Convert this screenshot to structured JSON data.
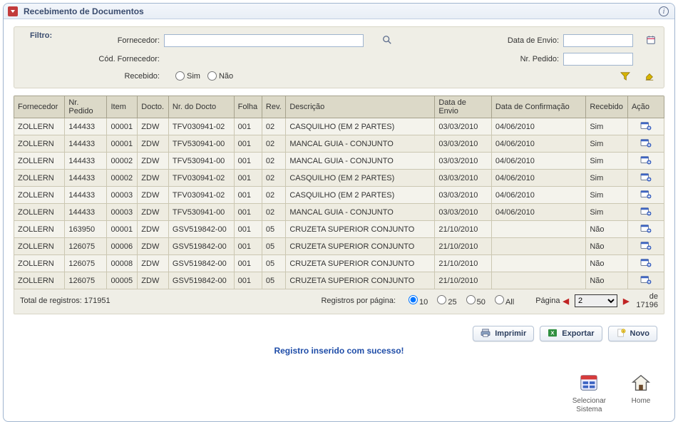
{
  "panel": {
    "title": "Recebimento de Documentos"
  },
  "filter": {
    "heading": "Filtro:",
    "fornecedor_label": "Fornecedor:",
    "fornecedor_value": "",
    "cod_fornecedor_label": "Cód. Fornecedor:",
    "data_envio_label": "Data de Envio:",
    "data_envio_value": "",
    "nr_pedido_label": "Nr. Pedido:",
    "nr_pedido_value": "",
    "recebido_label": "Recebido:",
    "sim": "Sim",
    "nao": "Não"
  },
  "columns": {
    "fornecedor": "Fornecedor",
    "nr_pedido": "Nr. Pedido",
    "item": "Item",
    "docto": "Docto.",
    "nr_docto": "Nr. do Docto",
    "folha": "Folha",
    "rev": "Rev.",
    "descricao": "Descrição",
    "data_envio": "Data de Envio",
    "data_conf": "Data de Confirmação",
    "recebido": "Recebido",
    "acao": "Ação"
  },
  "rows": [
    {
      "fornecedor": "ZOLLERN",
      "nr_pedido": "144433",
      "item": "00001",
      "docto": "ZDW",
      "nr_docto": "TFV030941-02",
      "folha": "001",
      "rev": "02",
      "descricao": "CASQUILHO (EM 2 PARTES)",
      "data_envio": "03/03/2010",
      "data_conf": "04/06/2010",
      "recebido": "Sim"
    },
    {
      "fornecedor": "ZOLLERN",
      "nr_pedido": "144433",
      "item": "00001",
      "docto": "ZDW",
      "nr_docto": "TFV530941-00",
      "folha": "001",
      "rev": "02",
      "descricao": "MANCAL GUIA - CONJUNTO",
      "data_envio": "03/03/2010",
      "data_conf": "04/06/2010",
      "recebido": "Sim"
    },
    {
      "fornecedor": "ZOLLERN",
      "nr_pedido": "144433",
      "item": "00002",
      "docto": "ZDW",
      "nr_docto": "TFV530941-00",
      "folha": "001",
      "rev": "02",
      "descricao": "MANCAL GUIA - CONJUNTO",
      "data_envio": "03/03/2010",
      "data_conf": "04/06/2010",
      "recebido": "Sim"
    },
    {
      "fornecedor": "ZOLLERN",
      "nr_pedido": "144433",
      "item": "00002",
      "docto": "ZDW",
      "nr_docto": "TFV030941-02",
      "folha": "001",
      "rev": "02",
      "descricao": "CASQUILHO (EM 2 PARTES)",
      "data_envio": "03/03/2010",
      "data_conf": "04/06/2010",
      "recebido": "Sim"
    },
    {
      "fornecedor": "ZOLLERN",
      "nr_pedido": "144433",
      "item": "00003",
      "docto": "ZDW",
      "nr_docto": "TFV030941-02",
      "folha": "001",
      "rev": "02",
      "descricao": "CASQUILHO (EM 2 PARTES)",
      "data_envio": "03/03/2010",
      "data_conf": "04/06/2010",
      "recebido": "Sim"
    },
    {
      "fornecedor": "ZOLLERN",
      "nr_pedido": "144433",
      "item": "00003",
      "docto": "ZDW",
      "nr_docto": "TFV530941-00",
      "folha": "001",
      "rev": "02",
      "descricao": "MANCAL GUIA - CONJUNTO",
      "data_envio": "03/03/2010",
      "data_conf": "04/06/2010",
      "recebido": "Sim"
    },
    {
      "fornecedor": "ZOLLERN",
      "nr_pedido": "163950",
      "item": "00001",
      "docto": "ZDW",
      "nr_docto": "GSV519842-00",
      "folha": "001",
      "rev": "05",
      "descricao": "CRUZETA SUPERIOR CONJUNTO",
      "data_envio": "21/10/2010",
      "data_conf": "",
      "recebido": "Não"
    },
    {
      "fornecedor": "ZOLLERN",
      "nr_pedido": "126075",
      "item": "00006",
      "docto": "ZDW",
      "nr_docto": "GSV519842-00",
      "folha": "001",
      "rev": "05",
      "descricao": "CRUZETA SUPERIOR CONJUNTO",
      "data_envio": "21/10/2010",
      "data_conf": "",
      "recebido": "Não"
    },
    {
      "fornecedor": "ZOLLERN",
      "nr_pedido": "126075",
      "item": "00008",
      "docto": "ZDW",
      "nr_docto": "GSV519842-00",
      "folha": "001",
      "rev": "05",
      "descricao": "CRUZETA SUPERIOR CONJUNTO",
      "data_envio": "21/10/2010",
      "data_conf": "",
      "recebido": "Não"
    },
    {
      "fornecedor": "ZOLLERN",
      "nr_pedido": "126075",
      "item": "00005",
      "docto": "ZDW",
      "nr_docto": "GSV519842-00",
      "folha": "001",
      "rev": "05",
      "descricao": "CRUZETA SUPERIOR CONJUNTO",
      "data_envio": "21/10/2010",
      "data_conf": "",
      "recebido": "Não"
    }
  ],
  "pager": {
    "total_label": "Total de registros:",
    "total_value": "171951",
    "perpage_label": "Registros por página:",
    "opt10": "10",
    "opt25": "25",
    "opt50": "50",
    "optAll": "All",
    "page_label": "Página",
    "current_page": "2",
    "de": "de",
    "total_pages": "17196"
  },
  "buttons": {
    "imprimir": "Imprimir",
    "exportar": "Exportar",
    "novo": "Novo"
  },
  "message": "Registro inserido com sucesso!",
  "tiles": {
    "selecionar": "Selecionar\nSistema",
    "home": "Home"
  }
}
